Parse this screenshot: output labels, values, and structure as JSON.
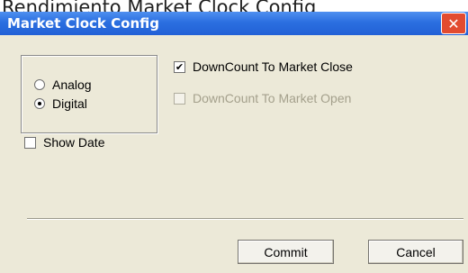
{
  "page": {
    "title": "Rendimiento Market Clock Config"
  },
  "window": {
    "title": "Market Clock Config",
    "close_label": "✕"
  },
  "mode_group": {
    "options": [
      {
        "label": "Analog",
        "selected": false
      },
      {
        "label": "Digital",
        "selected": true
      }
    ]
  },
  "options": {
    "countdown_close": {
      "label": "DownCount To Market Close",
      "checked": true,
      "enabled": true,
      "check_glyph": "✔"
    },
    "countdown_open": {
      "label": "DownCount To Market Open",
      "checked": false,
      "enabled": false
    },
    "show_date": {
      "label": "Show Date",
      "checked": false,
      "enabled": true
    }
  },
  "buttons": {
    "commit": "Commit",
    "cancel": "Cancel"
  },
  "icons": {
    "close": "close-icon"
  },
  "colors": {
    "titlebar": "#2b6fe0",
    "close_button": "#e24b30",
    "dialog_bg": "#ece9d8",
    "disabled_text": "#a4a08c"
  }
}
